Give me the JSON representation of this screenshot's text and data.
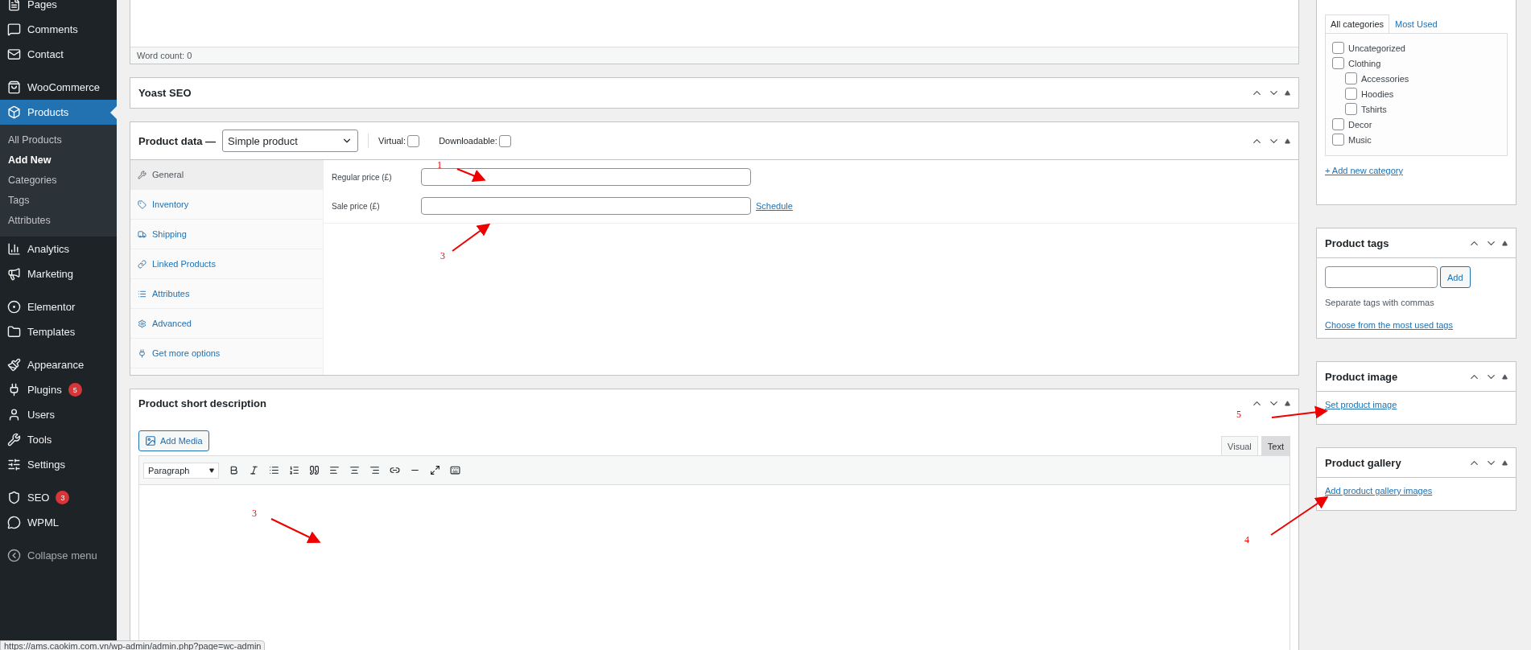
{
  "sidebar": {
    "groups": [
      [
        {
          "label": "Pages",
          "selected": false
        },
        {
          "label": "Comments",
          "selected": false
        },
        {
          "label": "Contact",
          "selected": false
        }
      ],
      [
        {
          "label": "WooCommerce",
          "selected": false
        },
        {
          "label": "Products",
          "selected": true,
          "children": [
            {
              "label": "All Products",
              "selected": false
            },
            {
              "label": "Add New",
              "selected": true
            },
            {
              "label": "Categories",
              "selected": false
            },
            {
              "label": "Tags",
              "selected": false
            },
            {
              "label": "Attributes",
              "selected": false
            }
          ]
        },
        {
          "label": "Analytics",
          "selected": false
        },
        {
          "label": "Marketing",
          "selected": false
        }
      ],
      [
        {
          "label": "Elementor",
          "selected": false
        },
        {
          "label": "Templates",
          "selected": false
        }
      ],
      [
        {
          "label": "Appearance",
          "selected": false
        },
        {
          "label": "Plugins",
          "selected": false,
          "badge": "5"
        },
        {
          "label": "Users",
          "selected": false
        },
        {
          "label": "Tools",
          "selected": false
        },
        {
          "label": "Settings",
          "selected": false
        }
      ],
      [
        {
          "label": "SEO",
          "selected": false,
          "badge": "3"
        },
        {
          "label": "WPML",
          "selected": false
        }
      ],
      [
        {
          "label": "Collapse menu",
          "selected": false,
          "kind": "collapse"
        }
      ]
    ]
  },
  "editor": {
    "word_count": "Word count: 0"
  },
  "yoast": {
    "title": "Yoast SEO"
  },
  "product_data": {
    "title": "Product data —",
    "type": "Simple product",
    "virtual": {
      "label": "Virtual:",
      "checked": false
    },
    "downloadable": {
      "label": "Downloadable:",
      "checked": false
    },
    "tabs": [
      {
        "label": "General",
        "selected": true
      },
      {
        "label": "Inventory",
        "selected": false
      },
      {
        "label": "Shipping",
        "selected": false
      },
      {
        "label": "Linked Products",
        "selected": false
      },
      {
        "label": "Attributes",
        "selected": false
      },
      {
        "label": "Advanced",
        "selected": false
      },
      {
        "label": "Get more options",
        "selected": false
      }
    ],
    "fields": [
      {
        "label": "Regular price (£)"
      },
      {
        "label": "Sale price (£)",
        "link": "Schedule"
      }
    ]
  },
  "short_description": {
    "title": "Product short description",
    "add_media": "Add Media",
    "tabs": [
      {
        "label": "Visual",
        "selected": true
      },
      {
        "label": "Text",
        "selected": false
      }
    ],
    "format": "Paragraph"
  },
  "categories": {
    "tabs": [
      {
        "label": "All categories",
        "selected": true
      },
      {
        "label": "Most Used",
        "selected": false
      }
    ],
    "items": [
      {
        "label": "Uncategorized",
        "checked": false
      },
      {
        "label": "Clothing",
        "checked": false,
        "children": [
          {
            "label": "Accessories",
            "checked": false
          },
          {
            "label": "Hoodies",
            "checked": false
          },
          {
            "label": "Tshirts",
            "checked": false
          }
        ]
      },
      {
        "label": "Decor",
        "checked": false
      },
      {
        "label": "Music",
        "checked": false
      }
    ],
    "add_link": "+ Add new category"
  },
  "product_tags": {
    "title": "Product tags",
    "button": "Add",
    "hint": "Separate tags with commas",
    "link": "Choose from the most used tags"
  },
  "product_image": {
    "title": "Product image",
    "link": "Set product image"
  },
  "product_gallery": {
    "title": "Product gallery",
    "link": "Add product gallery images"
  },
  "annotations": [
    "1",
    "3",
    "3",
    "5",
    "4"
  ],
  "status_url": "https://ams.caokim.com.vn/wp-admin/admin.php?page=wc-admin"
}
